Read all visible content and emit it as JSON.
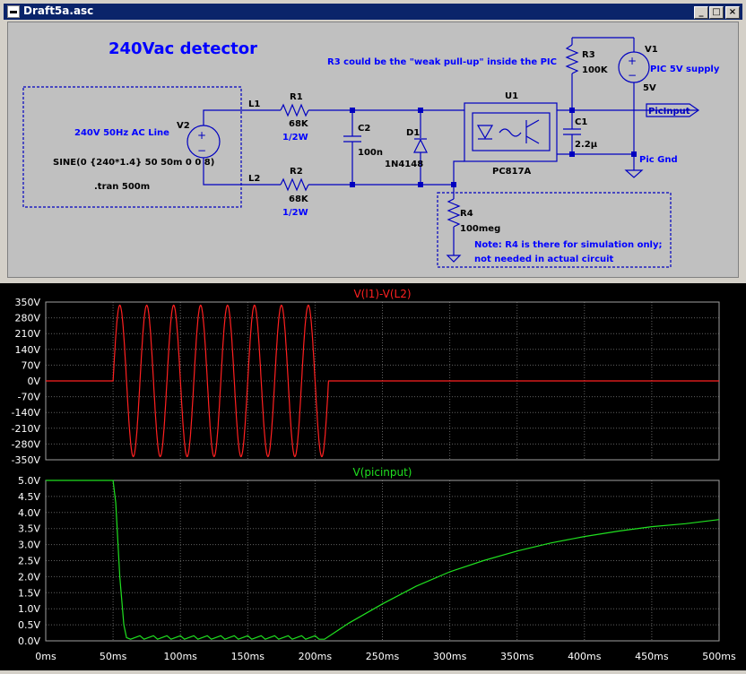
{
  "window": {
    "title": "Draft5a.asc",
    "buttons": {
      "minimize": "_",
      "maximize": "□",
      "close": "×"
    }
  },
  "schematic": {
    "heading": "240Vac detector",
    "note_r3": "R3 could be the \"weak pull-up\" inside the PIC",
    "ac_block": {
      "line1": "240V 50Hz AC Line",
      "line2": "SINE(0 {240*1.4} 50 50m 0 0 8)",
      "line3": ".tran 500m"
    },
    "nets": {
      "l1": "L1",
      "l2": "L2",
      "picinput": "PicInput",
      "picgnd": "Pic Gnd"
    },
    "v2": {
      "ref": "V2"
    },
    "r1": {
      "ref": "R1",
      "value": "68K",
      "rating": "1/2W"
    },
    "r2": {
      "ref": "R2",
      "value": "68K",
      "rating": "1/2W"
    },
    "c2": {
      "ref": "C2",
      "value": "100n"
    },
    "d1": {
      "ref": "D1",
      "value": "1N4148"
    },
    "u1": {
      "ref": "U1",
      "value": "PC817A"
    },
    "r3": {
      "ref": "R3",
      "value": "100K"
    },
    "c1": {
      "ref": "C1",
      "value": "2.2µ"
    },
    "v1": {
      "ref": "V1",
      "label": "PIC 5V supply",
      "value": "5V"
    },
    "r4": {
      "ref": "R4",
      "value": "100meg"
    },
    "note_r4": {
      "line1": "Note: R4 is there for simulation only;",
      "line2": "not needed in actual circuit"
    },
    "colors": {
      "wire": "#0000c0",
      "label": "#0000ff",
      "background": "#c0c0c0"
    }
  },
  "plots": {
    "x_ticks": [
      "0ms",
      "50ms",
      "100ms",
      "150ms",
      "200ms",
      "250ms",
      "300ms",
      "350ms",
      "400ms",
      "450ms",
      "500ms"
    ],
    "colors": {
      "trace1": "#ff2020",
      "trace2": "#20e020",
      "grid": "#606060",
      "frame": "#a0a0a0",
      "tick_text": "#ffffff"
    }
  },
  "chart_data": [
    {
      "type": "line",
      "title": "V(l1)-V(L2)",
      "xlabel": "",
      "ylabel": "",
      "xlim": [
        0,
        500
      ],
      "ylim": [
        -350,
        350
      ],
      "y_ticks": [
        "350V",
        "280V",
        "210V",
        "140V",
        "70V",
        "0V",
        "-70V",
        "-140V",
        "-210V",
        "-280V",
        "-350V"
      ],
      "grid": true,
      "series": [
        {
          "name": "V(l1)-V(L2)",
          "x": [
            0,
            50,
            210,
            500
          ],
          "y": [
            0,
            0,
            0,
            0
          ],
          "waveform": {
            "offset": 0,
            "amplitude": 336,
            "frequency_hz": 50,
            "start_ms": 50,
            "cycles": 8
          }
        }
      ]
    },
    {
      "type": "line",
      "title": "V(picinput)",
      "xlabel": "",
      "ylabel": "",
      "xlim": [
        0,
        500
      ],
      "ylim": [
        0,
        5
      ],
      "y_ticks": [
        "5.0V",
        "4.5V",
        "4.0V",
        "3.5V",
        "3.0V",
        "2.5V",
        "2.0V",
        "1.5V",
        "1.0V",
        "0.5V",
        "0.0V"
      ],
      "grid": true,
      "series": [
        {
          "name": "V(picinput)",
          "x": [
            0,
            50,
            52,
            55,
            58,
            60,
            63,
            70,
            73,
            80,
            83,
            90,
            93,
            100,
            103,
            110,
            113,
            120,
            123,
            130,
            133,
            140,
            143,
            150,
            153,
            160,
            163,
            170,
            173,
            180,
            183,
            190,
            193,
            200,
            203,
            207,
            225,
            250,
            275,
            300,
            325,
            350,
            375,
            400,
            425,
            450,
            475,
            500
          ],
          "y": [
            5.0,
            5.0,
            4.3,
            2.0,
            0.5,
            0.1,
            0.05,
            0.16,
            0.05,
            0.16,
            0.05,
            0.16,
            0.05,
            0.16,
            0.05,
            0.16,
            0.05,
            0.16,
            0.05,
            0.16,
            0.05,
            0.16,
            0.05,
            0.16,
            0.05,
            0.16,
            0.05,
            0.16,
            0.05,
            0.16,
            0.05,
            0.16,
            0.05,
            0.16,
            0.05,
            0.05,
            0.55,
            1.15,
            1.7,
            2.15,
            2.5,
            2.8,
            3.05,
            3.25,
            3.42,
            3.56,
            3.65,
            3.78
          ]
        }
      ]
    }
  ]
}
